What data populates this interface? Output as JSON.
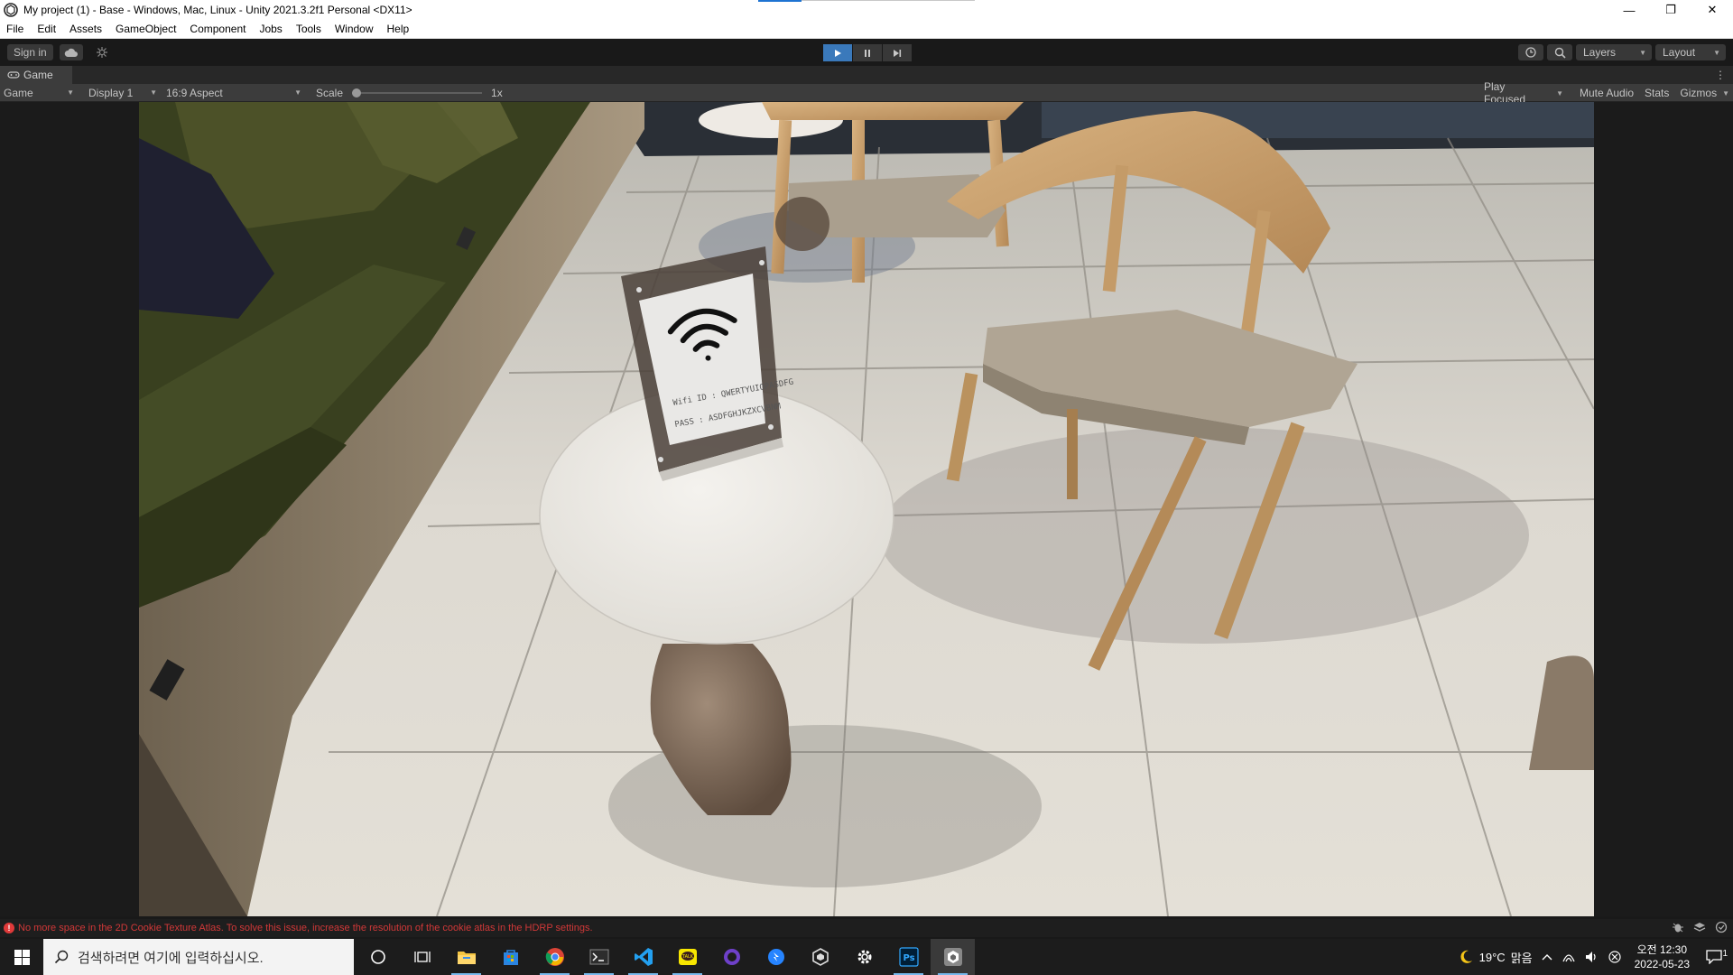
{
  "window": {
    "title": "My project (1) - Base - Windows, Mac, Linux - Unity 2021.3.2f1 Personal <DX11>",
    "controls": {
      "minimize": "—",
      "restore": "❐",
      "close": "✕"
    }
  },
  "menu": [
    "File",
    "Edit",
    "Assets",
    "GameObject",
    "Component",
    "Jobs",
    "Tools",
    "Window",
    "Help"
  ],
  "toolbar": {
    "sign_in": "Sign in",
    "play_active": true,
    "layers_label": "Layers",
    "layout_label": "Layout"
  },
  "game_tab": {
    "label": "Game"
  },
  "game_bar": {
    "mode": "Game",
    "display": "Display 1",
    "aspect": "16:9 Aspect",
    "scale_label": "Scale",
    "scale_value": "1x",
    "play_focused": "Play Focused",
    "mute_audio": "Mute Audio",
    "stats": "Stats",
    "gizmos": "Gizmos"
  },
  "scene": {
    "wifi_id": "Wifi ID : QWERTYUIOPASDFG",
    "wifi_pass": "PASS : ASDFGHJKZXCVBNM"
  },
  "status": {
    "message": "No more space in the 2D Cookie Texture Atlas. To solve this issue, increase the resolution of the cookie atlas in the HDRP settings.",
    "color": "#d03838"
  },
  "taskbar": {
    "search_placeholder": "검색하려면 여기에 입력하십시오.",
    "weather_temp": "19°C",
    "weather_text": "맑음",
    "time": "오전 12:30",
    "date": "2022-05-23",
    "notification_count": "1"
  }
}
